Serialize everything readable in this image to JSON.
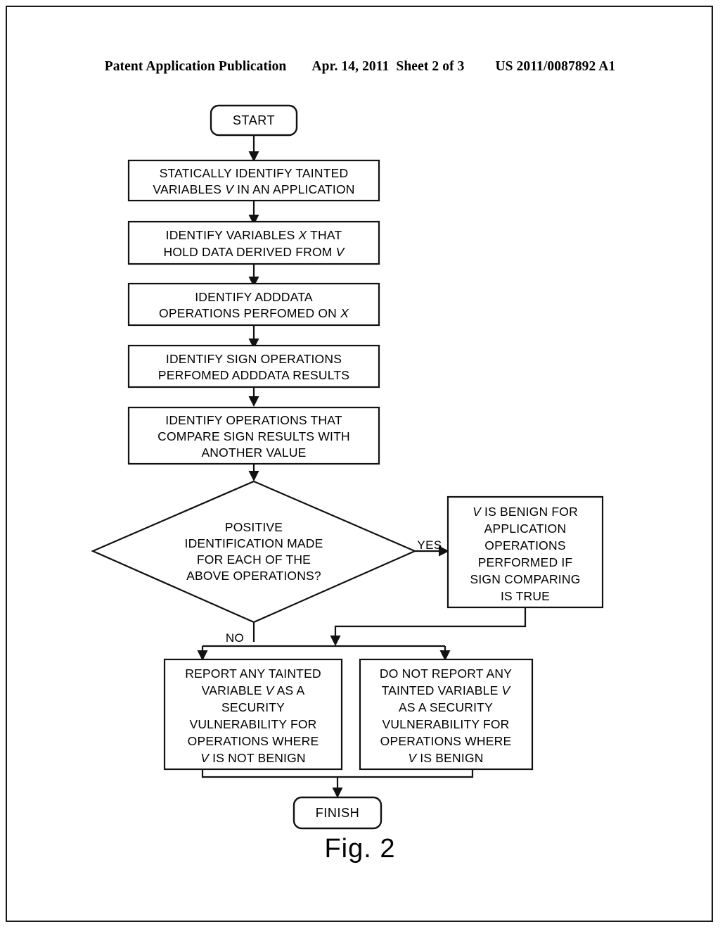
{
  "header": {
    "publication": "Patent Application Publication",
    "date": "Apr. 14, 2011",
    "sheet": "Sheet 2 of 3",
    "number": "US 2011/0087892 A1"
  },
  "figure": {
    "caption": "Fig. 2"
  },
  "flowchart": {
    "type": "flowchart",
    "start": {
      "label": "START"
    },
    "finish": {
      "label": "FINISH"
    },
    "steps": [
      {
        "id": "step-identify-tainted",
        "lines": [
          [
            {
              "t": "STATICALLY IDENTIFY TAINTED"
            }
          ],
          [
            {
              "t": "VARIABLES "
            },
            {
              "t": "V",
              "i": true
            },
            {
              "t": " IN AN APPLICATION"
            }
          ]
        ]
      },
      {
        "id": "step-identify-x",
        "lines": [
          [
            {
              "t": "IDENTIFY VARIABLES "
            },
            {
              "t": "X",
              "i": true
            },
            {
              "t": " THAT"
            }
          ],
          [
            {
              "t": "HOLD DATA DERIVED FROM "
            },
            {
              "t": "V",
              "i": true
            }
          ]
        ]
      },
      {
        "id": "step-identify-adddata",
        "lines": [
          [
            {
              "t": "IDENTIFY ADDDATA"
            }
          ],
          [
            {
              "t": "OPERATIONS PERFOMED ON "
            },
            {
              "t": "X",
              "i": true
            }
          ]
        ]
      },
      {
        "id": "step-identify-sign",
        "lines": [
          [
            {
              "t": "IDENTIFY SIGN OPERATIONS"
            }
          ],
          [
            {
              "t": "PERFOMED ADDDATA RESULTS"
            }
          ]
        ]
      },
      {
        "id": "step-identify-compare",
        "lines": [
          [
            {
              "t": "IDENTIFY OPERATIONS THAT"
            }
          ],
          [
            {
              "t": "COMPARE SIGN RESULTS WITH"
            }
          ],
          [
            {
              "t": "ANOTHER VALUE"
            }
          ]
        ]
      }
    ],
    "decision": {
      "id": "decision-positive-identification",
      "lines": [
        [
          {
            "t": "POSITIVE"
          }
        ],
        [
          {
            "t": "IDENTIFICATION MADE"
          }
        ],
        [
          {
            "t": "FOR EACH OF THE"
          }
        ],
        [
          {
            "t": "ABOVE OPERATIONS?"
          }
        ]
      ],
      "yes_label": "YES",
      "no_label": "NO"
    },
    "benign_box": {
      "id": "outcome-v-is-benign",
      "lines": [
        [
          {
            "t": "V",
            "i": true
          },
          {
            "t": " IS BENIGN FOR"
          }
        ],
        [
          {
            "t": "APPLICATION"
          }
        ],
        [
          {
            "t": "OPERATIONS"
          }
        ],
        [
          {
            "t": "PERFORMED IF"
          }
        ],
        [
          {
            "t": "SIGN COMPARING"
          }
        ],
        [
          {
            "t": "IS TRUE"
          }
        ]
      ]
    },
    "report_box": {
      "id": "outcome-report-vulnerability",
      "lines": [
        [
          {
            "t": "REPORT ANY TAINTED"
          }
        ],
        [
          {
            "t": "VARIABLE "
          },
          {
            "t": "V",
            "i": true
          },
          {
            "t": " AS A"
          }
        ],
        [
          {
            "t": "SECURITY"
          }
        ],
        [
          {
            "t": "VULNERABILITY FOR"
          }
        ],
        [
          {
            "t": "OPERATIONS WHERE"
          }
        ],
        [
          {
            "t": "V",
            "i": true
          },
          {
            "t": " IS NOT BENIGN"
          }
        ]
      ]
    },
    "no_report_box": {
      "id": "outcome-do-not-report",
      "lines": [
        [
          {
            "t": "DO NOT REPORT ANY"
          }
        ],
        [
          {
            "t": "TAINTED VARIABLE "
          },
          {
            "t": "V",
            "i": true
          }
        ],
        [
          {
            "t": "AS A SECURITY"
          }
        ],
        [
          {
            "t": "VULNERABILITY FOR"
          }
        ],
        [
          {
            "t": "OPERATIONS WHERE"
          }
        ],
        [
          {
            "t": "V",
            "i": true
          },
          {
            "t": " IS BENIGN"
          }
        ]
      ]
    },
    "colors": {
      "stroke": "#111111",
      "fill": "#ffffff",
      "text": "#000000"
    }
  }
}
